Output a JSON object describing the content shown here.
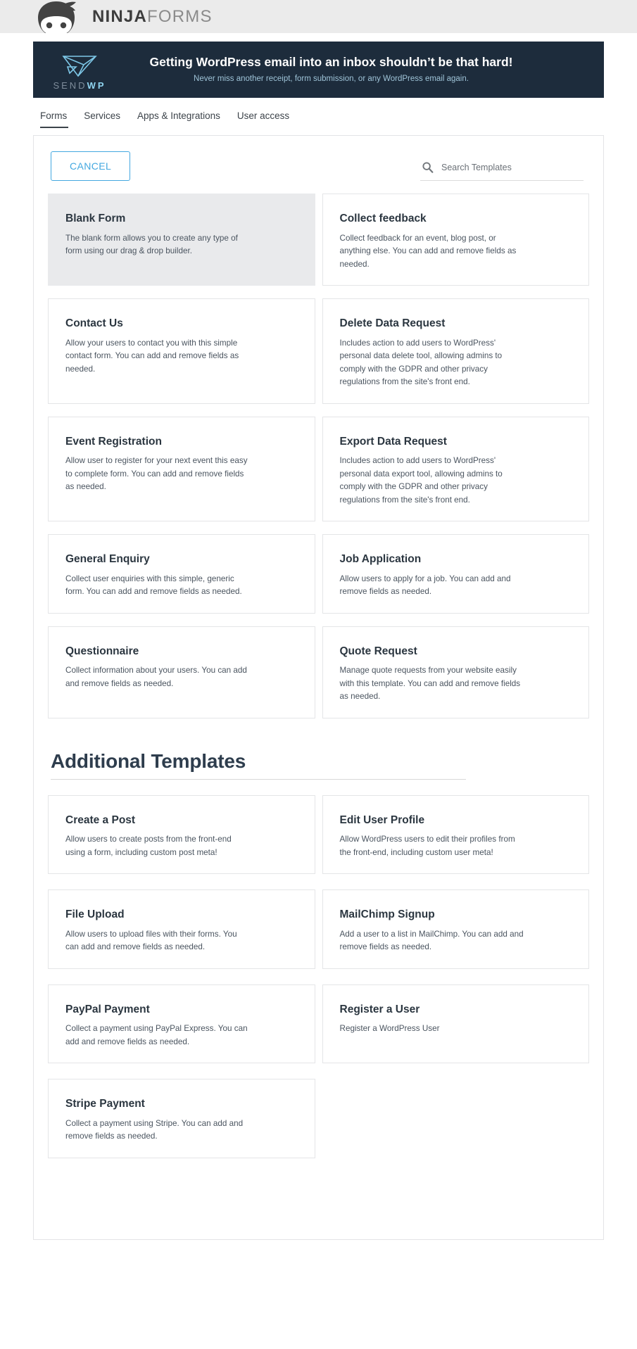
{
  "brand": {
    "name_bold": "NINJA",
    "name_light": "FORMS",
    "logo_icon": "ninja-mask-icon"
  },
  "promo": {
    "logo_icon": "paper-plane-icon",
    "logo_text_gray": "SEND",
    "logo_text_blue": "WP",
    "title": "Getting WordPress email into an inbox shouldn’t be that hard!",
    "subtitle": "Never miss another receipt, form submission, or any WordPress email again.",
    "background_color": "#1d2c3c",
    "title_color": "#ffffff",
    "subtitle_color": "#9fc4d8"
  },
  "tabs": [
    {
      "label": "Forms",
      "active": true
    },
    {
      "label": "Services",
      "active": false
    },
    {
      "label": "Apps & Integrations",
      "active": false
    },
    {
      "label": "User access",
      "active": false
    }
  ],
  "toolbar": {
    "cancel_label": "CANCEL",
    "cancel_color": "#44a8e0",
    "search_icon": "search-icon",
    "search_value": "",
    "search_placeholder": "Search Templates"
  },
  "templates": [
    {
      "title": "Blank Form",
      "description": "The blank form allows you to create any type of form using our drag & drop builder.",
      "selected": true
    },
    {
      "title": "Collect feedback",
      "description": "Collect feedback for an event, blog post, or anything else. You can add and remove fields as needed.",
      "selected": false
    },
    {
      "title": "Contact Us",
      "description": "Allow your users to contact you with this simple contact form. You can add and remove fields as needed.",
      "selected": false
    },
    {
      "title": "Delete Data Request",
      "description": "Includes action to add users to WordPress' personal data delete tool, allowing admins to comply with the GDPR and other privacy regulations from the site's front end.",
      "selected": false
    },
    {
      "title": "Event Registration",
      "description": "Allow user to register for your next event this easy to complete form. You can add and remove fields as needed.",
      "selected": false
    },
    {
      "title": "Export Data Request",
      "description": "Includes action to add users to WordPress' personal data export tool, allowing admins to comply with the GDPR and other privacy regulations from the site's front end.",
      "selected": false
    },
    {
      "title": "General Enquiry",
      "description": "Collect user enquiries with this simple, generic form. You can add and remove fields as needed.",
      "selected": false
    },
    {
      "title": "Job Application",
      "description": "Allow users to apply for a job. You can add and remove fields as needed.",
      "selected": false
    },
    {
      "title": "Questionnaire",
      "description": "Collect information about your users. You can add and remove fields as needed.",
      "selected": false
    },
    {
      "title": "Quote Request",
      "description": "Manage quote requests from your website easily with this template. You can add and remove fields as needed.",
      "selected": false
    }
  ],
  "additional_section": {
    "title": "Additional Templates"
  },
  "additional_templates": [
    {
      "title": "Create a Post",
      "description": "Allow users to create posts from the front-end using a form, including custom post meta!"
    },
    {
      "title": "Edit User Profile",
      "description": "Allow WordPress users to edit their profiles from the front-end, including custom user meta!"
    },
    {
      "title": "File Upload",
      "description": "Allow users to upload files with their forms. You can add and remove fields as needed."
    },
    {
      "title": "MailChimp Signup",
      "description": "Add a user to a list in MailChimp. You can add and remove fields as needed."
    },
    {
      "title": "PayPal Payment",
      "description": "Collect a payment using PayPal Express. You can add and remove fields as needed."
    },
    {
      "title": "Register a User",
      "description": "Register a WordPress User"
    },
    {
      "title": "Stripe Payment",
      "description": "Collect a payment using Stripe. You can add and remove fields as needed."
    }
  ]
}
